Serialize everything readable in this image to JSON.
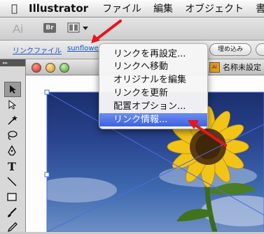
{
  "menubar": {
    "apple_icon": "apple-icon",
    "app_name": "Illustrator",
    "items": [
      "ファイル",
      "編集",
      "オブジェクト",
      "書"
    ]
  },
  "appbar": {
    "ai_logo": "Ai",
    "bridge_label": "Br"
  },
  "control_bar": {
    "linked_file_label": "リンクファイル",
    "file_name": "sunflower",
    "embed_button": "埋め込み"
  },
  "document": {
    "tab_icon": "Ai",
    "tab_title": "名称未設定"
  },
  "context_menu": {
    "items": [
      "リンクを再設定...",
      "リンクへ移動",
      "オリジナルを編集",
      "リンクを更新",
      "配置オプション...",
      "リンク情報..."
    ],
    "highlighted_index": 5
  },
  "annotation_color": "#e8141e",
  "highlight_color": "#3d62dc",
  "tools": [
    "selection-tool-icon",
    "direct-selection-tool-icon",
    "magic-wand-icon",
    "lasso-icon",
    "pen-tool-icon",
    "type-tool-icon",
    "line-tool-icon",
    "rectangle-tool-icon",
    "paintbrush-icon",
    "pencil-icon"
  ]
}
